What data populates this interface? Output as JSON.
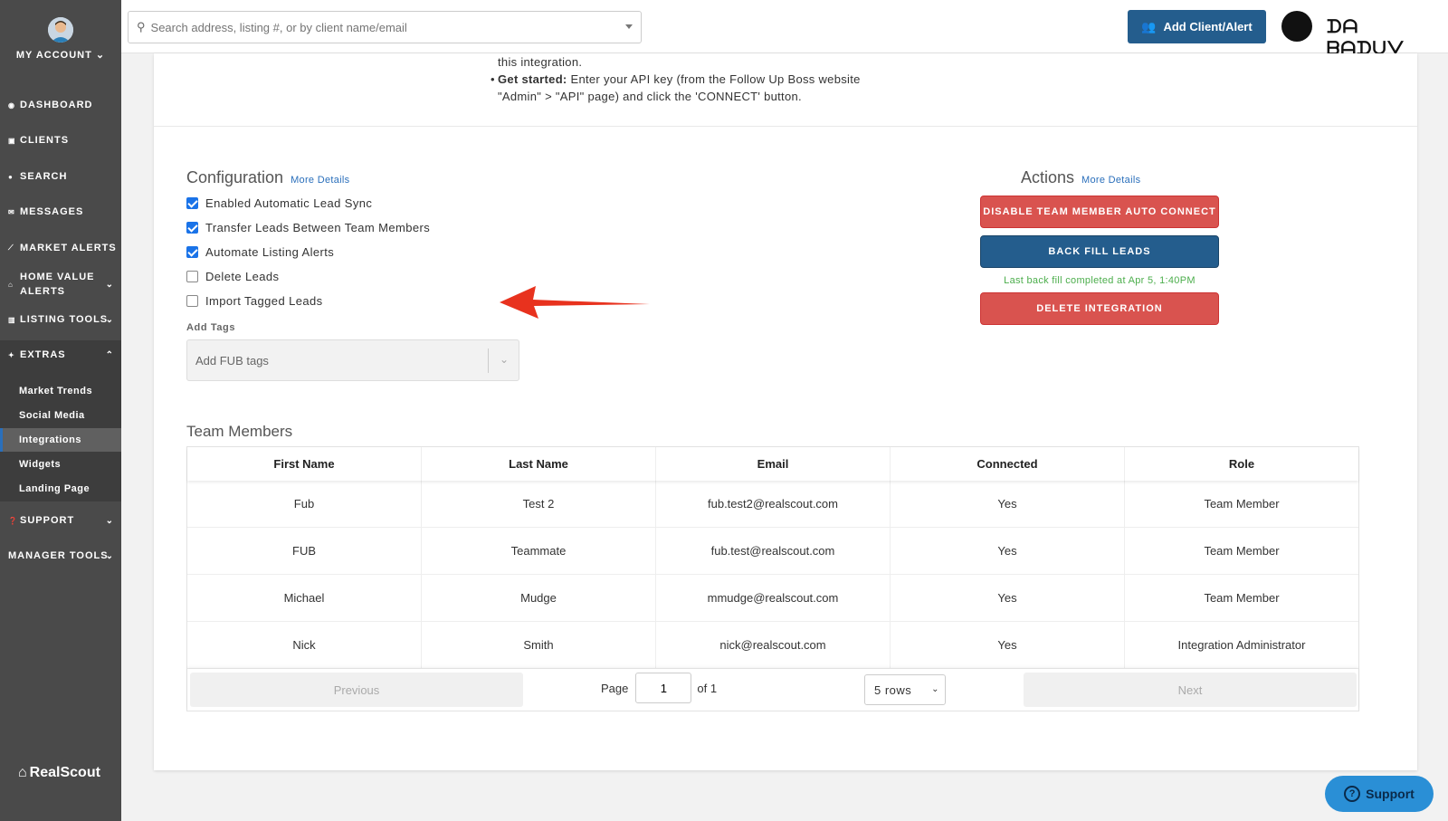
{
  "sidebar": {
    "account_label": "MY ACCOUNT",
    "items": [
      {
        "label": "DASHBOARD",
        "icon": "dashboard-icon"
      },
      {
        "label": "CLIENTS",
        "icon": "clients-icon"
      },
      {
        "label": "SEARCH",
        "icon": "map-pin-icon"
      },
      {
        "label": "MESSAGES",
        "icon": "envelope-icon"
      },
      {
        "label": "MARKET ALERTS",
        "icon": "chart-icon"
      },
      {
        "label": "HOME VALUE ALERTS",
        "icon": "home-icon"
      },
      {
        "label": "LISTING TOOLS",
        "icon": "bar-chart-icon"
      },
      {
        "label": "EXTRAS",
        "icon": "gift-icon"
      },
      {
        "label": "SUPPORT",
        "icon": "question-icon"
      },
      {
        "label": "MANAGER TOOLS",
        "icon": ""
      }
    ],
    "extras_sub": [
      "Market Trends",
      "Social Media",
      "Integrations",
      "Widgets",
      "Landing Page"
    ],
    "active_sub": "Integrations",
    "logo_text": "RealScout"
  },
  "topbar": {
    "search_placeholder": "Search address, listing #, or by client name/email",
    "add_client_label": "Add Client/Alert",
    "brand_text": "ᗪᗩ ᗷᗩᗪᑌᐯ"
  },
  "intro": {
    "line1": "this integration.",
    "get_started_bold": "Get started:",
    "get_started_text": " Enter your API key (from the Follow Up Boss website",
    "line3": "\"Admin\" > \"API\" page) and click the 'CONNECT' button."
  },
  "configuration": {
    "title": "Configuration",
    "more_details": "More Details",
    "options": [
      {
        "label": "Enabled Automatic Lead Sync",
        "checked": true
      },
      {
        "label": "Transfer Leads Between Team Members",
        "checked": true
      },
      {
        "label": "Automate Listing Alerts",
        "checked": true
      },
      {
        "label": "Delete Leads",
        "checked": false
      },
      {
        "label": "Import Tagged Leads",
        "checked": false
      }
    ],
    "add_tags_label": "Add Tags",
    "add_tags_placeholder": "Add FUB tags"
  },
  "actions": {
    "title": "Actions",
    "more_details": "More Details",
    "disable_label": "DISABLE TEAM MEMBER AUTO CONNECT",
    "backfill_label": "BACK FILL LEADS",
    "backfill_note": "Last back fill completed at Apr 5, 1:40PM",
    "delete_label": "DELETE INTEGRATION"
  },
  "team": {
    "title": "Team Members",
    "columns": [
      "First Name",
      "Last Name",
      "Email",
      "Connected",
      "Role"
    ],
    "rows": [
      [
        "Fub",
        "Test 2",
        "fub.test2@realscout.com",
        "Yes",
        "Team Member"
      ],
      [
        "FUB",
        "Teammate",
        "fub.test@realscout.com",
        "Yes",
        "Team Member"
      ],
      [
        "Michael",
        "Mudge",
        "mmudge@realscout.com",
        "Yes",
        "Team Member"
      ],
      [
        "Nick",
        "Smith",
        "nick@realscout.com",
        "Yes",
        "Integration Administrator"
      ]
    ],
    "pager": {
      "previous": "Previous",
      "page_label": "Page",
      "page_value": "1",
      "of_label": "of 1",
      "rows_value": "5 rows",
      "next": "Next"
    }
  },
  "support_label": "Support",
  "colors": {
    "sidebar_bg": "#4a4a4a",
    "primary_blue": "#245d8d",
    "danger_red": "#d9534f",
    "link_blue": "#2a6fbb",
    "success_green": "#4cae4c",
    "annotation_arrow": "#e8321e"
  }
}
